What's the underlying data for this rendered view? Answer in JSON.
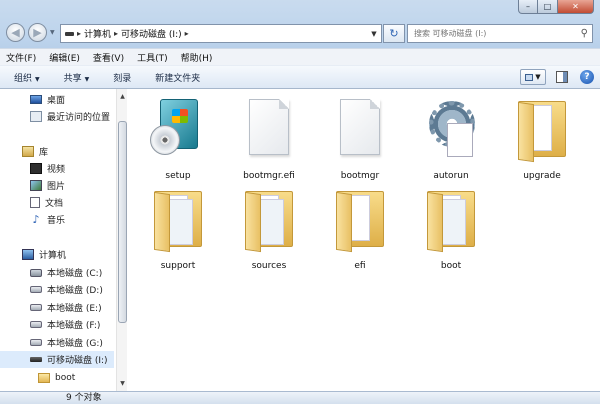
{
  "address": {
    "segments": [
      "计算机",
      "可移动磁盘 (I:)"
    ],
    "search_placeholder": "搜索 可移动磁盘 (I:)"
  },
  "menu": [
    "文件(F)",
    "编辑(E)",
    "查看(V)",
    "工具(T)",
    "帮助(H)"
  ],
  "toolbar": {
    "organize": "组织",
    "share": "共享",
    "burn": "刻录",
    "new_folder": "新建文件夹"
  },
  "nav": {
    "desktop": "桌面",
    "recent": "最近访问的位置",
    "libraries": "库",
    "videos": "视频",
    "pictures": "图片",
    "documents": "文档",
    "music": "音乐",
    "computer": "计算机",
    "drives": [
      "本地磁盘 (C:)",
      "本地磁盘 (D:)",
      "本地磁盘 (E:)",
      "本地磁盘 (F:)",
      "本地磁盘 (G:)"
    ],
    "removable": "可移动磁盘 (I:)",
    "boot_folder": "boot"
  },
  "files": [
    {
      "name": "setup",
      "kind": "setup-icon"
    },
    {
      "name": "bootmgr.efi",
      "kind": "file-icon"
    },
    {
      "name": "bootmgr",
      "kind": "file-icon"
    },
    {
      "name": "autorun",
      "kind": "settings-file-icon"
    },
    {
      "name": "upgrade",
      "kind": "folder-icon"
    },
    {
      "name": "support",
      "kind": "folder-icon"
    },
    {
      "name": "sources",
      "kind": "folder-icon"
    },
    {
      "name": "efi",
      "kind": "folder-icon"
    },
    {
      "name": "boot",
      "kind": "folder-icon"
    }
  ],
  "status": "9 个对象",
  "colors": {
    "frame": "#bcd3ec",
    "selection": "#dcebfc",
    "folder": "#e2b654"
  }
}
